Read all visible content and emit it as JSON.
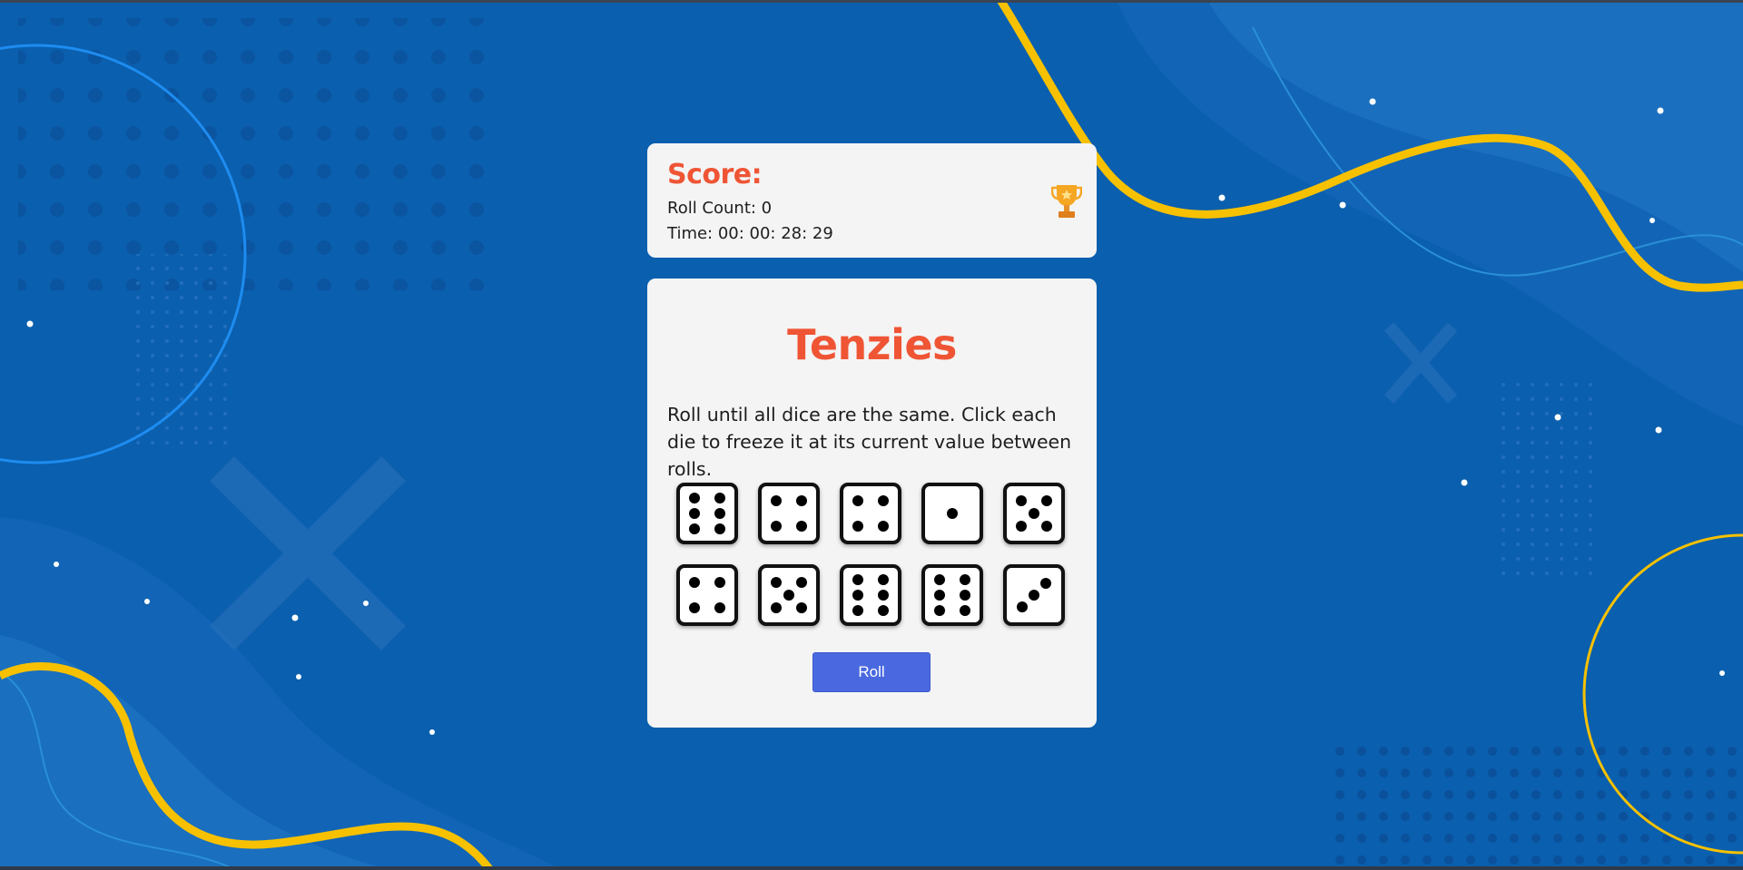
{
  "score": {
    "title": "Score:",
    "roll_count": "Roll Count: 0",
    "time": "Time: 00: 00: 28: 29",
    "icon": "trophy-icon"
  },
  "game": {
    "title": "Tenzies",
    "description": "Roll until all dice are the same. Click each die to freeze it at its current value between rolls.",
    "dice": [
      6,
      4,
      4,
      1,
      5,
      4,
      5,
      6,
      6,
      3
    ],
    "roll_label": "Roll"
  },
  "colors": {
    "accent": "#ef5535",
    "button": "#4a69e0",
    "background": "#0a5fae",
    "decor_yellow": "#f7c100"
  }
}
